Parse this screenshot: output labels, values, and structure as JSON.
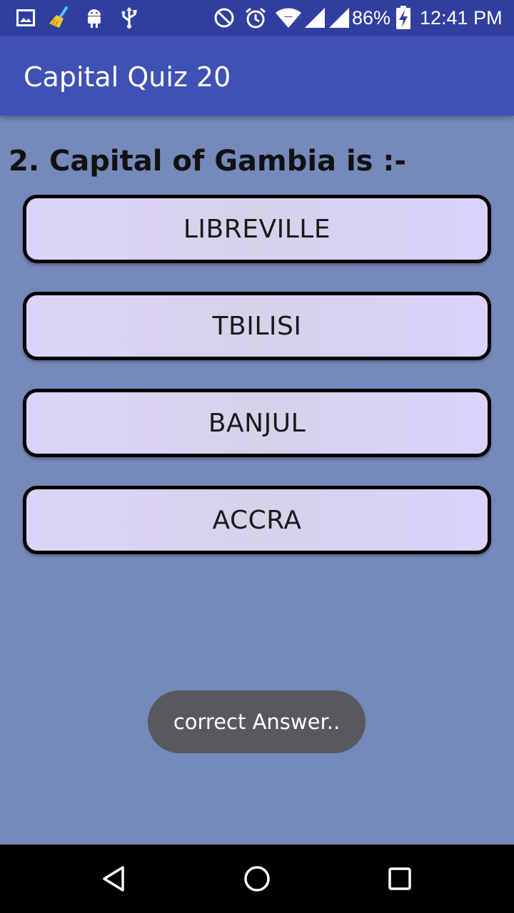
{
  "status_bar": {
    "battery": "86%",
    "time": "12:41 PM",
    "icons": [
      "gallery-icon",
      "cleaner-icon",
      "android-icon",
      "usb-icon",
      "do-not-disturb-icon",
      "alarm-icon",
      "wifi-icon",
      "signal-icon",
      "signal-icon",
      "battery-charging-icon"
    ]
  },
  "app_bar": {
    "title": "Capital Quiz 20"
  },
  "question": {
    "text": "2. Capital of Gambia is :-"
  },
  "options": [
    {
      "label": "LIBREVILLE"
    },
    {
      "label": "TBILISI"
    },
    {
      "label": "BANJUL"
    },
    {
      "label": "ACCRA"
    }
  ],
  "toast": {
    "message": "correct Answer.."
  },
  "nav_bar": {
    "icons": [
      "back-icon",
      "home-icon",
      "recents-icon"
    ]
  },
  "colors": {
    "status_bar": "#303f9f",
    "app_bar": "#3f51b5",
    "background": "#7589ba",
    "option_fill": "#dbd4f8",
    "toast": "#58595d"
  }
}
